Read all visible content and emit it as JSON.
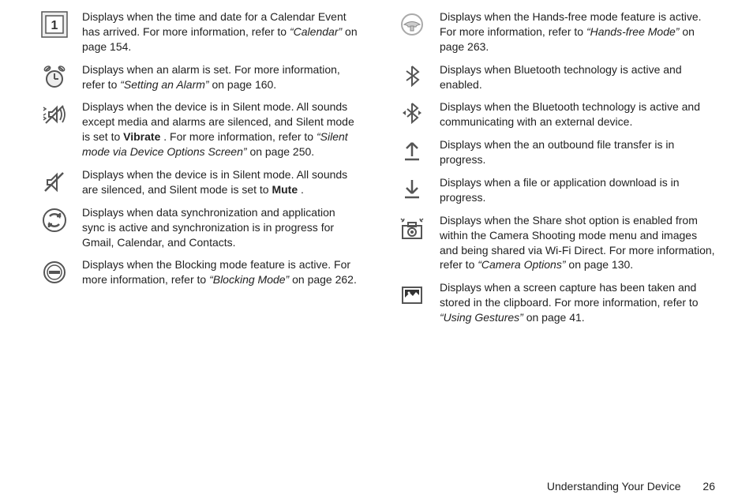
{
  "left": [
    {
      "pre": "Displays when the time and date for a Calendar Event has arrived. For more information, refer to ",
      "ref": "“Calendar”",
      "post": " on page 154."
    },
    {
      "pre": "Displays when an alarm is set.\nFor more information, refer to ",
      "ref": "“Setting an Alarm”",
      "post": " on page 160."
    },
    {
      "pre": "Displays when the device is in Silent mode.\nAll sounds except media and alarms are silenced, and Silent mode is set to ",
      "bold": "Vibrate",
      "mid": ". For more information, refer to ",
      "ref": "“Silent mode via Device Options Screen”",
      "post": " on page 250."
    },
    {
      "pre": "Displays when the device is in Silent mode.\nAll sounds are silenced, and Silent mode is set to ",
      "bold": "Mute",
      "mid": ".",
      "ref": "",
      "post": ""
    },
    {
      "pre": "Displays when data synchronization and application sync is active and synchronization is in progress for Gmail, Calendar, and Contacts.",
      "ref": "",
      "post": ""
    },
    {
      "pre": "Displays when the Blocking mode feature is active. For more information, refer to ",
      "ref": "“Blocking Mode”",
      "post": " on page 262."
    }
  ],
  "right": [
    {
      "pre": "Displays when the Hands-free mode feature is active. For more information, refer to ",
      "ref": "“Hands-free Mode”",
      "post": " on page 263."
    },
    {
      "pre": "Displays when Bluetooth technology is active and enabled.",
      "ref": "",
      "post": ""
    },
    {
      "pre": "Displays when the Bluetooth technology is active and communicating with an external device.",
      "ref": "",
      "post": ""
    },
    {
      "pre": "Displays when the an outbound file transfer is in progress.",
      "ref": "",
      "post": ""
    },
    {
      "pre": "Displays when a file or application download is in progress.",
      "ref": "",
      "post": ""
    },
    {
      "pre": "Displays when the Share shot option is enabled from within the Camera Shooting mode menu and images and being shared via Wi-Fi Direct.\nFor more information, refer to ",
      "ref": "“Camera Options”",
      "post": " on page 130."
    },
    {
      "pre": "Displays when a screen capture has been taken and stored in the clipboard.\nFor more information, refer to ",
      "ref": "“Using Gestures”",
      "post": " on page 41."
    }
  ],
  "footer": {
    "section": "Understanding Your Device",
    "page": "26"
  }
}
